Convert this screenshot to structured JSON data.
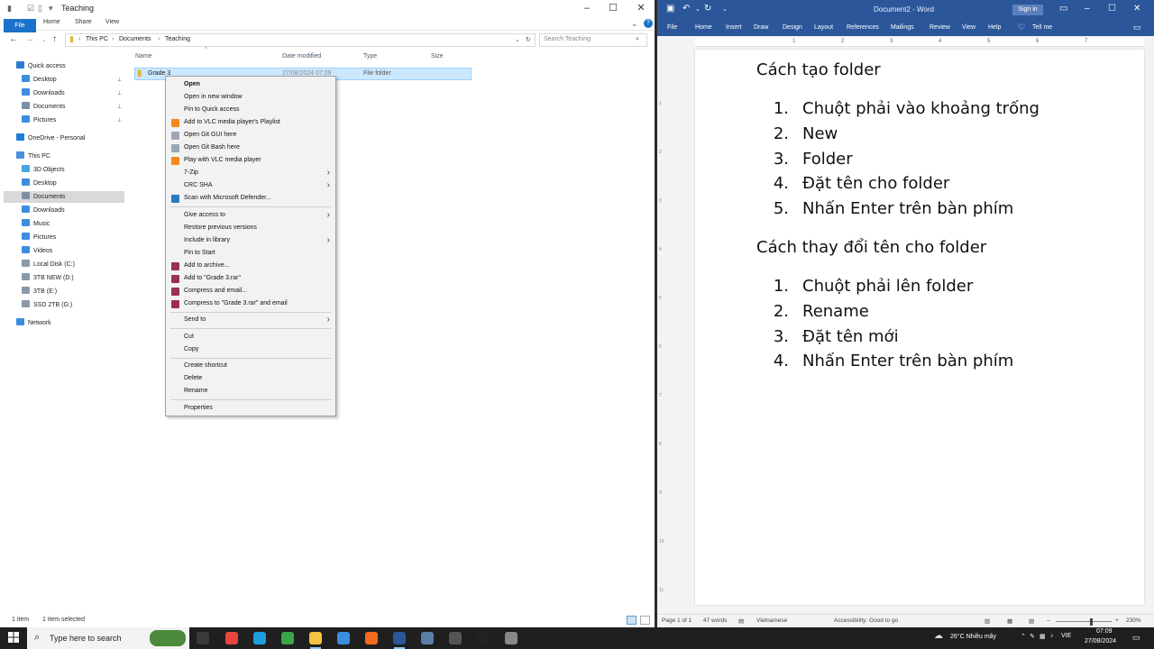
{
  "explorer": {
    "title": "Teaching",
    "ribbon_tabs": [
      "File",
      "Home",
      "Share",
      "View"
    ],
    "breadcrumb": [
      "This PC",
      "Documents",
      "Teaching"
    ],
    "search_placeholder": "Search Teaching",
    "nav": [
      {
        "label": "Quick access",
        "icon": "star-icon",
        "color": "#2d7bd4"
      },
      {
        "label": "Desktop",
        "icon": "desktop-icon",
        "color": "#3b8ede",
        "pinned": true
      },
      {
        "label": "Downloads",
        "icon": "download-icon",
        "color": "#3b8ede",
        "pinned": true
      },
      {
        "label": "Documents",
        "icon": "documents-icon",
        "color": "#7a8fa8",
        "pinned": true
      },
      {
        "label": "Pictures",
        "icon": "pictures-icon",
        "color": "#3b8ede",
        "pinned": true
      },
      {
        "label": "OneDrive - Personal",
        "icon": "cloud-icon",
        "color": "#1e7fd8"
      },
      {
        "label": "This PC",
        "icon": "pc-icon",
        "color": "#4a90d9"
      },
      {
        "label": "3D Objects",
        "icon": "cube-icon",
        "color": "#4aa3df"
      },
      {
        "label": "Desktop",
        "icon": "desktop-icon",
        "color": "#3b8ede"
      },
      {
        "label": "Documents",
        "icon": "documents-icon",
        "color": "#7a8fa8",
        "selected": true
      },
      {
        "label": "Downloads",
        "icon": "download-icon",
        "color": "#3b8ede"
      },
      {
        "label": "Music",
        "icon": "music-icon",
        "color": "#3b8ede"
      },
      {
        "label": "Pictures",
        "icon": "pictures-icon",
        "color": "#3b8ede"
      },
      {
        "label": "Videos",
        "icon": "video-icon",
        "color": "#3b8ede"
      },
      {
        "label": "Local Disk (C:)",
        "icon": "drive-icon",
        "color": "#8a9aaa"
      },
      {
        "label": "3TB NEW (D:)",
        "icon": "drive-icon",
        "color": "#8a9aaa"
      },
      {
        "label": "3TB (E:)",
        "icon": "drive-icon",
        "color": "#8a9aaa"
      },
      {
        "label": "SSD 2TB (G:)",
        "icon": "drive-icon",
        "color": "#8a9aaa"
      },
      {
        "label": "Network",
        "icon": "network-icon",
        "color": "#3b8ede"
      }
    ],
    "columns": [
      "Name",
      "Date modified",
      "Type",
      "Size"
    ],
    "row": {
      "name": "Grade 3",
      "date": "27/08/2024 07:09",
      "type": "File folder"
    },
    "status": {
      "items": "1 item",
      "selected": "1 item selected"
    }
  },
  "context_menu": [
    {
      "label": "Open",
      "bold": true
    },
    {
      "label": "Open in new window"
    },
    {
      "label": "Pin to Quick access"
    },
    {
      "label": "Add to VLC media player's Playlist",
      "icon": "vlc-icon",
      "color": "#f08a1d"
    },
    {
      "label": "Open Git GUI here",
      "icon": "git-icon",
      "color": "#9aa8b8"
    },
    {
      "label": "Open Git Bash here",
      "icon": "git-icon",
      "color": "#9aa8b8"
    },
    {
      "label": "Play with VLC media player",
      "icon": "vlc-icon",
      "color": "#f08a1d"
    },
    {
      "label": "7-Zip",
      "submenu": true
    },
    {
      "label": "CRC SHA",
      "submenu": true
    },
    {
      "label": "Scan with Microsoft Defender...",
      "icon": "defender-icon",
      "color": "#2b78c5",
      "sep_after": true
    },
    {
      "label": "Give access to",
      "submenu": true
    },
    {
      "label": "Restore previous versions"
    },
    {
      "label": "Include in library",
      "submenu": true
    },
    {
      "label": "Pin to Start"
    },
    {
      "label": "Add to archive...",
      "icon": "winrar-icon",
      "color": "#9b2d5a"
    },
    {
      "label": "Add to \"Grade 3.rar\"",
      "icon": "winrar-icon",
      "color": "#9b2d5a"
    },
    {
      "label": "Compress and email...",
      "icon": "winrar-icon",
      "color": "#9b2d5a"
    },
    {
      "label": "Compress to \"Grade 3.rar\" and email",
      "icon": "winrar-icon",
      "color": "#9b2d5a",
      "sep_after": true
    },
    {
      "label": "Send to",
      "submenu": true,
      "sep_after": true
    },
    {
      "label": "Cut"
    },
    {
      "label": "Copy",
      "sep_after": true
    },
    {
      "label": "Create shortcut"
    },
    {
      "label": "Delete"
    },
    {
      "label": "Rename",
      "sep_after": true
    },
    {
      "label": "Properties"
    }
  ],
  "word": {
    "title": "Document2 - Word",
    "sign_in": "Sign in",
    "tabs": [
      "File",
      "Home",
      "Insert",
      "Draw",
      "Design",
      "Layout",
      "References",
      "Mailings",
      "Review",
      "View",
      "Help",
      "Tell me"
    ],
    "doc": {
      "heading1": "Cách tạo folder",
      "list1": [
        "Chuột phải vào khoảng trống",
        "New",
        "Folder",
        "Đặt tên cho folder",
        "Nhấn Enter trên bàn phím"
      ],
      "heading2": "Cách thay đổi tên cho folder",
      "list2": [
        "Chuột phải lên folder",
        "Rename",
        "Đặt tên mới",
        "Nhấn Enter trên bàn phím"
      ]
    },
    "status": {
      "page": "Page 1 of 1",
      "words": "47 words",
      "language": "Vietnamese",
      "accessibility": "Accessibility: Good to go",
      "zoom": "230%"
    }
  },
  "taskbar": {
    "search_placeholder": "Type here to search",
    "weather": "26°C  Nhiều mây",
    "lang": "VIE",
    "time": "07:09",
    "date": "27/08/2024",
    "apps": [
      {
        "name": "task-view-icon",
        "color": "#3a3a3a"
      },
      {
        "name": "chrome-icon",
        "color": "#e8453c"
      },
      {
        "name": "edge-icon",
        "color": "#1c9de0"
      },
      {
        "name": "greenshot-icon",
        "color": "#3aa54a"
      },
      {
        "name": "file-explorer-icon",
        "color": "#f2c241",
        "active": true
      },
      {
        "name": "store-icon",
        "color": "#3b8ede"
      },
      {
        "name": "firefox-icon",
        "color": "#f26b21"
      },
      {
        "name": "word-icon",
        "color": "#2b579a",
        "active": true
      },
      {
        "name": "app-icon",
        "color": "#5a7fa6"
      },
      {
        "name": "settings-icon",
        "color": "#555"
      },
      {
        "name": "capcut-icon",
        "color": "#222"
      },
      {
        "name": "app2-icon",
        "color": "#888"
      }
    ]
  }
}
